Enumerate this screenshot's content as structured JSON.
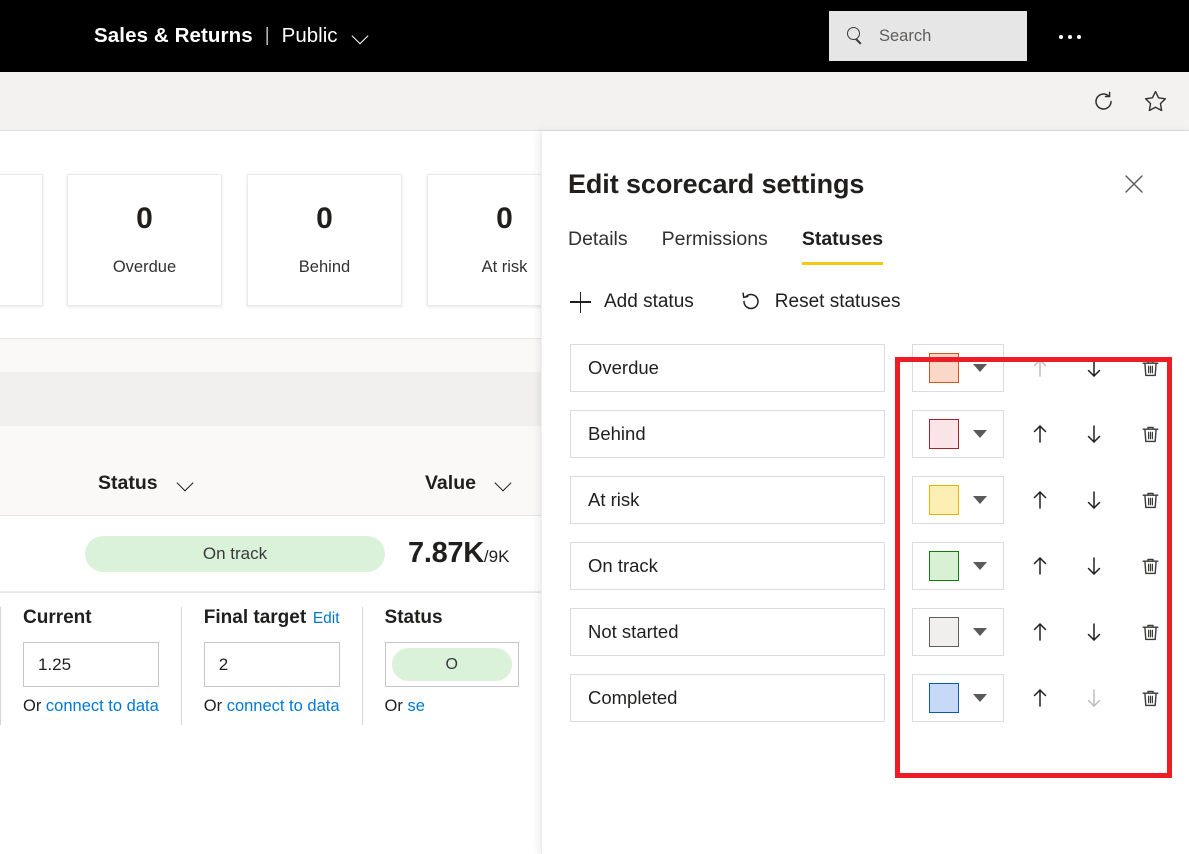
{
  "topbar": {
    "app_title": "Sales & Returns",
    "separator": "|",
    "workspace": "Public",
    "workspace_chevron_icon": "chevron-down-icon",
    "search_placeholder": "Search",
    "search_value": "",
    "search_icon": "search-icon",
    "overflow_icon": "ellipsis-icon"
  },
  "subbar": {
    "refresh_icon": "refresh-icon",
    "favorite_icon": "star-icon"
  },
  "main": {
    "cards": [
      {
        "value": "",
        "label": ""
      },
      {
        "value": "0",
        "label": "Overdue"
      },
      {
        "value": "0",
        "label": "Behind"
      },
      {
        "value": "0",
        "label": "At risk"
      }
    ],
    "table": {
      "columns": [
        {
          "title": "Status",
          "sort_icon": "chevron-down-icon"
        },
        {
          "title": "Value",
          "sort_icon": "chevron-down-icon"
        }
      ],
      "rows": [
        {
          "status": "On track",
          "status_color": "#d9f2d9",
          "value_main": "7.87K",
          "value_sub": "/9K"
        }
      ]
    },
    "editor": {
      "current": {
        "label": "Current",
        "value": "1.25",
        "or_text": "Or ",
        "link_text": "connect to data"
      },
      "final_target": {
        "label": "Final target",
        "edit_link": "Edit",
        "value": "2",
        "or_text": "Or ",
        "link_text": "connect to data"
      },
      "status": {
        "label": "Status",
        "pill_text": "O",
        "or_text": "Or ",
        "link_text": "se"
      }
    }
  },
  "panel": {
    "title": "Edit scorecard settings",
    "close_icon": "close-icon",
    "tabs": [
      {
        "label": "Details",
        "active": false
      },
      {
        "label": "Permissions",
        "active": false
      },
      {
        "label": "Statuses",
        "active": true
      }
    ],
    "active_tab_underline_color": "#f2c811",
    "toolbar": {
      "add_status_label": "Add status",
      "add_status_icon": "plus-icon",
      "reset_statuses_label": "Reset statuses",
      "reset_statuses_icon": "reset-icon"
    },
    "statuses": [
      {
        "name": "Overdue",
        "color_fill": "#fad8c7",
        "color_border": "#d9541a",
        "move_up_enabled": false,
        "move_down_enabled": true,
        "delete_enabled": true
      },
      {
        "name": "Behind",
        "color_fill": "#fbe4e7",
        "color_border": "#a4262c",
        "move_up_enabled": true,
        "move_down_enabled": true,
        "delete_enabled": true
      },
      {
        "name": "At risk",
        "color_fill": "#fdeeb3",
        "color_border": "#e8b400",
        "move_up_enabled": true,
        "move_down_enabled": true,
        "delete_enabled": true
      },
      {
        "name": "On track",
        "color_fill": "#d8f0d3",
        "color_border": "#107c10",
        "move_up_enabled": true,
        "move_down_enabled": true,
        "delete_enabled": true
      },
      {
        "name": "Not started",
        "color_fill": "#f0efee",
        "color_border": "#605e5c",
        "move_up_enabled": true,
        "move_down_enabled": true,
        "delete_enabled": true
      },
      {
        "name": "Completed",
        "color_fill": "#c6daf7",
        "color_border": "#0f5aa6",
        "move_up_enabled": true,
        "move_down_enabled": false,
        "delete_enabled": true
      }
    ],
    "row_icons": {
      "move_up_icon": "arrow-up-icon",
      "move_down_icon": "arrow-down-icon",
      "delete_icon": "trash-icon",
      "color_dropdown_icon": "caret-down-icon"
    }
  },
  "annotation": {
    "color": "#ee1c25"
  }
}
